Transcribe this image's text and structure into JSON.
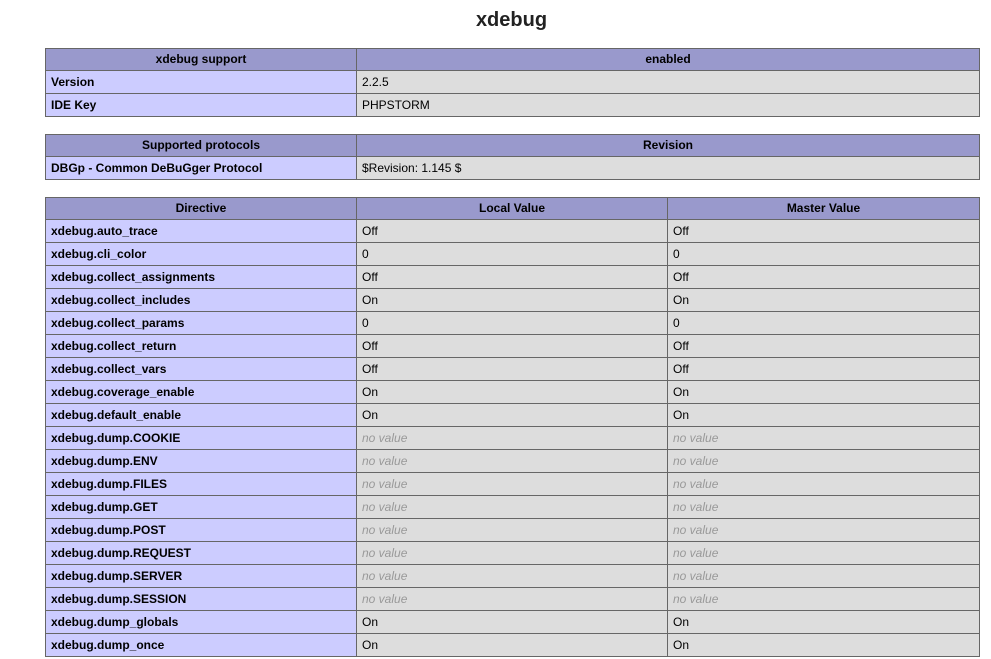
{
  "page": {
    "title": "xdebug"
  },
  "support_table": {
    "header": [
      "xdebug support",
      "enabled"
    ],
    "rows": [
      {
        "key": "Version",
        "value": "2.2.5"
      },
      {
        "key": "IDE Key",
        "value": "PHPSTORM"
      }
    ]
  },
  "protocols_table": {
    "header": [
      "Supported protocols",
      "Revision"
    ],
    "rows": [
      {
        "key": "DBGp - Common DeBuGger Protocol",
        "value": "$Revision: 1.145 $"
      }
    ]
  },
  "directives_table": {
    "header": [
      "Directive",
      "Local Value",
      "Master Value"
    ],
    "rows": [
      {
        "directive": "xdebug.auto_trace",
        "local": "Off",
        "master": "Off"
      },
      {
        "directive": "xdebug.cli_color",
        "local": "0",
        "master": "0"
      },
      {
        "directive": "xdebug.collect_assignments",
        "local": "Off",
        "master": "Off"
      },
      {
        "directive": "xdebug.collect_includes",
        "local": "On",
        "master": "On"
      },
      {
        "directive": "xdebug.collect_params",
        "local": "0",
        "master": "0"
      },
      {
        "directive": "xdebug.collect_return",
        "local": "Off",
        "master": "Off"
      },
      {
        "directive": "xdebug.collect_vars",
        "local": "Off",
        "master": "Off"
      },
      {
        "directive": "xdebug.coverage_enable",
        "local": "On",
        "master": "On"
      },
      {
        "directive": "xdebug.default_enable",
        "local": "On",
        "master": "On"
      },
      {
        "directive": "xdebug.dump.COOKIE",
        "local": "no value",
        "master": "no value"
      },
      {
        "directive": "xdebug.dump.ENV",
        "local": "no value",
        "master": "no value"
      },
      {
        "directive": "xdebug.dump.FILES",
        "local": "no value",
        "master": "no value"
      },
      {
        "directive": "xdebug.dump.GET",
        "local": "no value",
        "master": "no value"
      },
      {
        "directive": "xdebug.dump.POST",
        "local": "no value",
        "master": "no value"
      },
      {
        "directive": "xdebug.dump.REQUEST",
        "local": "no value",
        "master": "no value"
      },
      {
        "directive": "xdebug.dump.SERVER",
        "local": "no value",
        "master": "no value"
      },
      {
        "directive": "xdebug.dump.SESSION",
        "local": "no value",
        "master": "no value"
      },
      {
        "directive": "xdebug.dump_globals",
        "local": "On",
        "master": "On"
      },
      {
        "directive": "xdebug.dump_once",
        "local": "On",
        "master": "On"
      }
    ]
  },
  "colors": {
    "header_bg": "#9999cc",
    "key_bg": "#ccccff",
    "value_bg": "#dddddd",
    "no_value_text": "#999999"
  }
}
